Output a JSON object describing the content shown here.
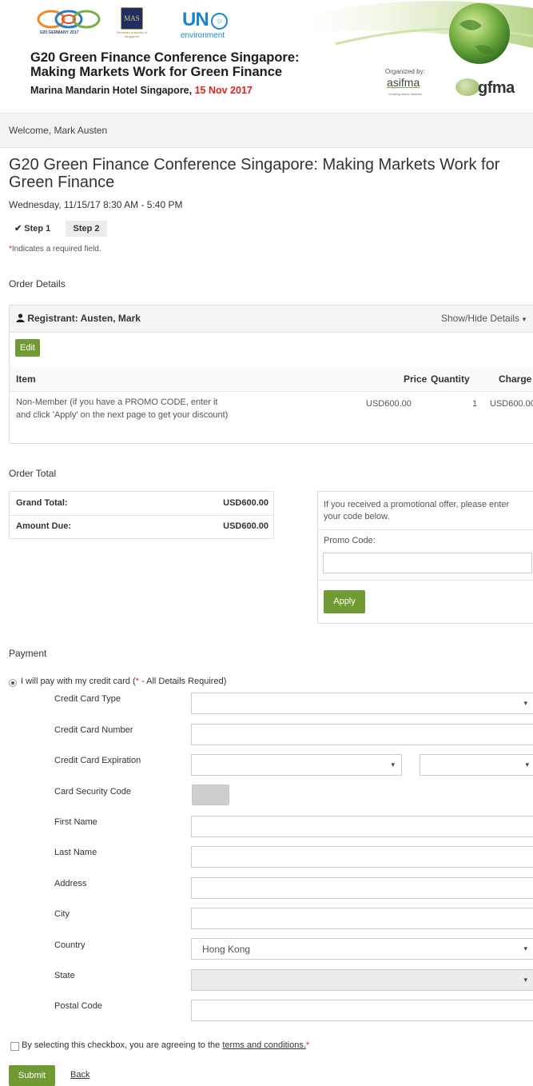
{
  "banner": {
    "g20_caption": "G20 GERMANY 2017",
    "mas_logo": "MAS",
    "mas_caption": "Monetary Authority of Singapore",
    "un_logo": "UN",
    "un_caption": "environment",
    "title_line1": "G20 Green Finance Conference Singapore:",
    "title_line2": "Making Markets Work for Green Finance",
    "venue": "Marina Mandarin Hotel Singapore, ",
    "date": "15 Nov 2017",
    "organized_by": "Organized by:",
    "asifma": "asifma",
    "asifma_tagline": "Growing Asia's Markets",
    "gfma": "gfma"
  },
  "welcome": "Welcome, Mark Austen",
  "page_title": "G20 Green Finance Conference Singapore: Making Markets Work for Green Finance",
  "event_datetime": "Wednesday, 11/15/17 8:30 AM - 5:40 PM",
  "steps": [
    {
      "label": "Step 1",
      "completed": true
    },
    {
      "label": "Step 2",
      "completed": false
    }
  ],
  "required_note": "Indicates a required field.",
  "order_details": {
    "heading": "Order Details",
    "registrant": "Registrant: Austen, Mark",
    "show_hide": "Show/Hide Details",
    "edit_label": "Edit",
    "columns": {
      "item": "Item",
      "price": "Price",
      "quantity": "Quantity",
      "charge": "Charge"
    },
    "rows": [
      {
        "item": "Non-Member (if you have a PROMO CODE, enter it and click 'Apply' on the next page to get your discount)",
        "price": "USD600.00",
        "quantity": "1",
        "charge": "USD600.00"
      }
    ]
  },
  "order_total": {
    "heading": "Order Total",
    "grand_total_label": "Grand Total:",
    "grand_total": "USD600.00",
    "amount_due_label": "Amount Due:",
    "amount_due": "USD600.00"
  },
  "promo": {
    "text": "If you received a promotional offer, please enter your code below.",
    "label": "Promo Code:",
    "value": "",
    "apply_label": "Apply"
  },
  "payment": {
    "heading": "Payment",
    "option_label": "I will pay with my credit card (",
    "option_note": " - All Details Required)",
    "fields": {
      "card_type": {
        "label": "Credit Card Type",
        "value": ""
      },
      "card_number": {
        "label": "Credit Card Number",
        "value": ""
      },
      "card_expiration": {
        "label": "Credit Card Expiration",
        "month": "",
        "year": ""
      },
      "security_code": {
        "label": "Card Security Code"
      },
      "first_name": {
        "label": "First Name",
        "value": ""
      },
      "last_name": {
        "label": "Last Name",
        "value": ""
      },
      "address": {
        "label": "Address",
        "value": ""
      },
      "city": {
        "label": "City",
        "value": ""
      },
      "country": {
        "label": "Country",
        "value": "Hong Kong"
      },
      "state": {
        "label": "State",
        "value": ""
      },
      "postal_code": {
        "label": "Postal Code",
        "value": ""
      }
    }
  },
  "terms": {
    "text": "By selecting this checkbox, you are agreeing to the ",
    "link": "terms and conditions.",
    "checked": false
  },
  "actions": {
    "submit_label": "Submit",
    "back_label": "Back"
  },
  "colors": {
    "brand_green": "#6f9a34",
    "required_red": "#e2231a",
    "un_blue": "#1a87c9"
  },
  "icons": {
    "step_check": "check-icon",
    "registrant": "user-icon",
    "show_hide": "caret-down-icon"
  }
}
